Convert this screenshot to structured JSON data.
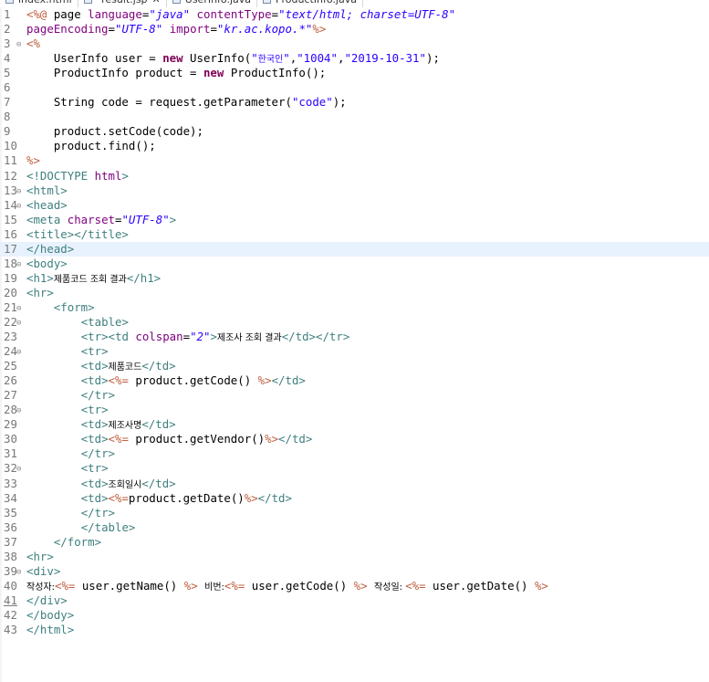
{
  "tabs": [
    {
      "label": "index.html",
      "active": false,
      "closable": false
    },
    {
      "label": "*result.jsp",
      "active": true,
      "closable": true
    },
    {
      "label": "UserInfo.java",
      "active": false,
      "closable": false
    },
    {
      "label": "ProductInfo.java",
      "active": false,
      "closable": false
    }
  ],
  "close_glyph": "✕",
  "current_line": 17,
  "lines": [
    {
      "n": "1",
      "fold": "",
      "segs": [
        [
          "jsp",
          "<%@ "
        ],
        [
          "",
          "page "
        ],
        [
          "attr",
          "language"
        ],
        [
          "",
          "="
        ],
        [
          "str ital",
          "\"java\""
        ],
        [
          "",
          ""
        ],
        [
          "",
          " "
        ],
        [
          "attr",
          "contentType"
        ],
        [
          "",
          "="
        ],
        [
          "str ital",
          "\"text/html; charset=UTF-8\""
        ]
      ]
    },
    {
      "n": "2",
      "fold": "",
      "segs": [
        [
          "attr",
          "pageEncoding"
        ],
        [
          "",
          "="
        ],
        [
          "str ital",
          "\"UTF-8\""
        ],
        [
          "",
          " "
        ],
        [
          "attr",
          "import"
        ],
        [
          "",
          "="
        ],
        [
          "str ital",
          "\"kr.ac.kopo.*\""
        ],
        [
          "jsp",
          "%>"
        ]
      ]
    },
    {
      "n": "3",
      "fold": "⊖",
      "segs": [
        [
          "jsp",
          "<%"
        ]
      ]
    },
    {
      "n": "4",
      "fold": "",
      "segs": [
        [
          "",
          "    UserInfo user = "
        ],
        [
          "kw",
          "new"
        ],
        [
          "",
          " UserInfo("
        ],
        [
          "str",
          "\""
        ],
        [
          "str ko",
          "한국인"
        ],
        [
          "str",
          "\""
        ],
        [
          "",
          ","
        ],
        [
          "str",
          "\"1004\""
        ],
        [
          "",
          ","
        ],
        [
          "str",
          "\"2019-10-31\""
        ],
        [
          "",
          ");"
        ]
      ]
    },
    {
      "n": "5",
      "fold": "",
      "segs": [
        [
          "",
          "    ProductInfo product = "
        ],
        [
          "kw",
          "new"
        ],
        [
          "",
          " ProductInfo();"
        ]
      ]
    },
    {
      "n": "6",
      "fold": "",
      "segs": []
    },
    {
      "n": "7",
      "fold": "",
      "segs": [
        [
          "",
          "    String code = request.getParameter("
        ],
        [
          "str",
          "\"code\""
        ],
        [
          "",
          ");"
        ]
      ]
    },
    {
      "n": "8",
      "fold": "",
      "segs": []
    },
    {
      "n": "9",
      "fold": "",
      "segs": [
        [
          "",
          "    product.setCode(code);"
        ]
      ]
    },
    {
      "n": "10",
      "fold": "",
      "segs": [
        [
          "",
          "    product.find();"
        ]
      ]
    },
    {
      "n": "11",
      "fold": "",
      "segs": [
        [
          "jsp",
          "%>"
        ]
      ]
    },
    {
      "n": "12",
      "fold": "",
      "segs": [
        [
          "tag",
          "<!DOCTYPE "
        ],
        [
          "attr",
          "html"
        ],
        [
          "tag",
          ">"
        ]
      ]
    },
    {
      "n": "13",
      "fold": "⊖",
      "segs": [
        [
          "tag",
          "<html>"
        ]
      ]
    },
    {
      "n": "14",
      "fold": "⊖",
      "segs": [
        [
          "tag",
          "<head>"
        ]
      ]
    },
    {
      "n": "15",
      "fold": "",
      "segs": [
        [
          "tag",
          "<meta "
        ],
        [
          "attr",
          "charset"
        ],
        [
          "",
          "="
        ],
        [
          "str ital",
          "\"UTF-8\""
        ],
        [
          "tag",
          ">"
        ]
      ]
    },
    {
      "n": "16",
      "fold": "",
      "segs": [
        [
          "tag",
          "<title></title>"
        ]
      ]
    },
    {
      "n": "17",
      "fold": "",
      "segs": [
        [
          "tag",
          "</head>"
        ]
      ]
    },
    {
      "n": "18",
      "fold": "⊖",
      "segs": [
        [
          "tag",
          "<body>"
        ]
      ]
    },
    {
      "n": "19",
      "fold": "",
      "segs": [
        [
          "tag",
          "<h1>"
        ],
        [
          "ko",
          "제품코드 조회 결과"
        ],
        [
          "tag",
          "</h1>"
        ]
      ]
    },
    {
      "n": "20",
      "fold": "",
      "segs": [
        [
          "tag",
          "<hr>"
        ]
      ]
    },
    {
      "n": "21",
      "fold": "⊖",
      "segs": [
        [
          "",
          "    "
        ],
        [
          "tag",
          "<form>"
        ]
      ]
    },
    {
      "n": "22",
      "fold": "⊖",
      "segs": [
        [
          "",
          "        "
        ],
        [
          "tag",
          "<table>"
        ]
      ]
    },
    {
      "n": "23",
      "fold": "",
      "segs": [
        [
          "",
          "        "
        ],
        [
          "tag",
          "<tr><td "
        ],
        [
          "attr",
          "colspan"
        ],
        [
          "",
          "="
        ],
        [
          "str ital",
          "\"2\""
        ],
        [
          "tag",
          ">"
        ],
        [
          "ko",
          "제조사 조회 결과"
        ],
        [
          "tag",
          "</td></tr>"
        ]
      ]
    },
    {
      "n": "24",
      "fold": "⊖",
      "segs": [
        [
          "",
          "        "
        ],
        [
          "tag",
          "<tr>"
        ]
      ]
    },
    {
      "n": "25",
      "fold": "",
      "segs": [
        [
          "",
          "        "
        ],
        [
          "tag",
          "<td>"
        ],
        [
          "ko",
          "제품코드"
        ],
        [
          "tag",
          "</td>"
        ]
      ]
    },
    {
      "n": "26",
      "fold": "",
      "segs": [
        [
          "",
          "        "
        ],
        [
          "tag",
          "<td>"
        ],
        [
          "jsp",
          "<%= "
        ],
        [
          "",
          "product.getCode() "
        ],
        [
          "jsp",
          "%>"
        ],
        [
          "tag",
          "</td>"
        ]
      ]
    },
    {
      "n": "27",
      "fold": "",
      "segs": [
        [
          "",
          "        "
        ],
        [
          "tag",
          "</tr>"
        ]
      ]
    },
    {
      "n": "28",
      "fold": "⊖",
      "segs": [
        [
          "",
          "        "
        ],
        [
          "tag",
          "<tr>"
        ]
      ]
    },
    {
      "n": "29",
      "fold": "",
      "segs": [
        [
          "",
          "        "
        ],
        [
          "tag",
          "<td>"
        ],
        [
          "ko",
          "제조사명"
        ],
        [
          "tag",
          "</td>"
        ]
      ]
    },
    {
      "n": "30",
      "fold": "",
      "segs": [
        [
          "",
          "        "
        ],
        [
          "tag",
          "<td>"
        ],
        [
          "jsp",
          "<%= "
        ],
        [
          "",
          "product.getVendor()"
        ],
        [
          "jsp",
          "%>"
        ],
        [
          "tag",
          "</td>"
        ]
      ]
    },
    {
      "n": "31",
      "fold": "",
      "segs": [
        [
          "",
          "        "
        ],
        [
          "tag",
          "</tr>"
        ]
      ]
    },
    {
      "n": "32",
      "fold": "⊖",
      "segs": [
        [
          "",
          "        "
        ],
        [
          "tag",
          "<tr>"
        ]
      ]
    },
    {
      "n": "33",
      "fold": "",
      "segs": [
        [
          "",
          "        "
        ],
        [
          "tag",
          "<td>"
        ],
        [
          "ko",
          "조회일시"
        ],
        [
          "tag",
          "</td>"
        ]
      ]
    },
    {
      "n": "34",
      "fold": "",
      "segs": [
        [
          "",
          "        "
        ],
        [
          "tag",
          "<td>"
        ],
        [
          "jsp",
          "<%="
        ],
        [
          "",
          "product.getDate()"
        ],
        [
          "jsp",
          "%>"
        ],
        [
          "tag",
          "</td>"
        ]
      ]
    },
    {
      "n": "35",
      "fold": "",
      "segs": [
        [
          "",
          "        "
        ],
        [
          "tag",
          "</tr>"
        ]
      ]
    },
    {
      "n": "36",
      "fold": "",
      "segs": [
        [
          "",
          "        "
        ],
        [
          "tag",
          "</table>"
        ]
      ]
    },
    {
      "n": "37",
      "fold": "",
      "segs": [
        [
          "",
          "    "
        ],
        [
          "tag",
          "</form>"
        ]
      ]
    },
    {
      "n": "38",
      "fold": "",
      "segs": [
        [
          "tag",
          "<hr>"
        ]
      ]
    },
    {
      "n": "39",
      "fold": "⊖",
      "segs": [
        [
          "tag",
          "<div>"
        ]
      ]
    },
    {
      "n": "40",
      "fold": "",
      "segs": [
        [
          "ko",
          "작성자:"
        ],
        [
          "jsp",
          "<%= "
        ],
        [
          "",
          "user.getName() "
        ],
        [
          "jsp",
          "%>"
        ],
        [
          "",
          " "
        ],
        [
          "ko",
          "비번:"
        ],
        [
          "jsp",
          "<%= "
        ],
        [
          "",
          "user.getCode() "
        ],
        [
          "jsp",
          "%>"
        ],
        [
          "",
          " "
        ],
        [
          "ko",
          "작성일: "
        ],
        [
          "jsp",
          "<%= "
        ],
        [
          "",
          "user.getDate() "
        ],
        [
          "jsp",
          "%>"
        ]
      ]
    },
    {
      "n": "41",
      "fold": "",
      "segs": [
        [
          "tag",
          "</div>"
        ]
      ]
    },
    {
      "n": "42",
      "fold": "",
      "segs": [
        [
          "tag",
          "</body>"
        ]
      ]
    },
    {
      "n": "43",
      "fold": "",
      "segs": [
        [
          "tag",
          "</html>"
        ]
      ]
    }
  ]
}
